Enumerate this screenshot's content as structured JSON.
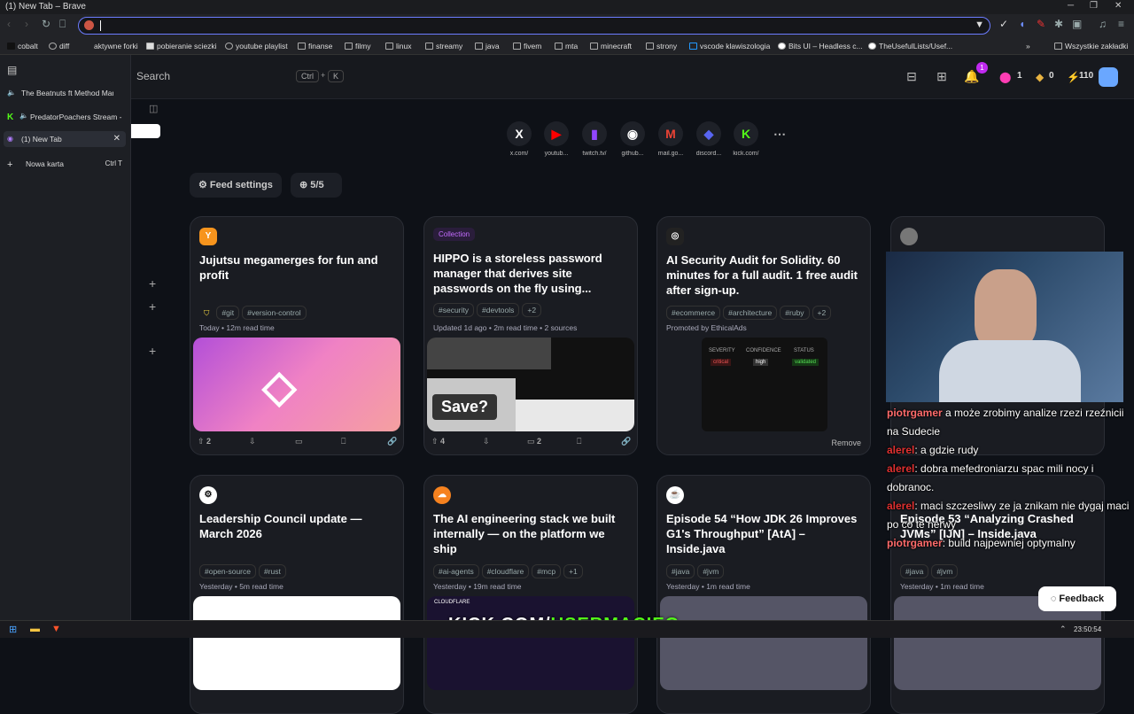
{
  "window": {
    "title": "(1) New Tab – Brave"
  },
  "bookmarks": [
    "cobalt",
    "diff",
    "aktywne forki",
    "pobieranie sciezki",
    "youtube playlist",
    "finanse",
    "filmy",
    "linux",
    "streamy",
    "java",
    "fivem",
    "mta",
    "minecraft",
    "strony",
    "vscode klawiszologia",
    "Bits UI – Headless c...",
    "TheUsefulLists/Usef...",
    "Wszystkie zakładki"
  ],
  "sidebar": {
    "tabs": [
      "The Beatnuts ft Method Man -",
      "PredatorPoachers Stream -",
      "(1) New Tab"
    ],
    "new_tab": "Nowa karta",
    "new_tab_kbd": "Ctrl  T"
  },
  "header": {
    "search": "Search",
    "kbd1": "Ctrl",
    "kbd_plus": "+",
    "kbd2": "K",
    "notif_count": "1",
    "stat_reputation": "1",
    "stat_coins": "0",
    "stat_cores": "110"
  },
  "shortcuts": [
    {
      "name": "x.com/",
      "glyph": "X",
      "color": "#ffffff"
    },
    {
      "name": "youtub...",
      "glyph": "▶",
      "color": "#ff0000"
    },
    {
      "name": "twitch.tv/",
      "glyph": "▮",
      "color": "#9146ff"
    },
    {
      "name": "github...",
      "glyph": "◉",
      "color": "#ffffff"
    },
    {
      "name": "mail.go...",
      "glyph": "M",
      "color": "#ea4335"
    },
    {
      "name": "discord...",
      "glyph": "◆",
      "color": "#5865f2"
    },
    {
      "name": "kick.com/",
      "glyph": "K",
      "color": "#53fc18"
    }
  ],
  "feed": {
    "settings": "Feed settings",
    "count": "5/5",
    "feedback": "Feedback"
  },
  "cards": [
    {
      "title": "Jujutsu megamerges for fun and profit",
      "tags": [
        "#git",
        "#version-control"
      ],
      "meta": "Today • 12m read time",
      "up": "2",
      "comments": ""
    },
    {
      "label": "Collection",
      "title": "HIPPO is a storeless password manager that derives site passwords on the fly using...",
      "tags": [
        "#security",
        "#devtools",
        "+2"
      ],
      "meta": "Updated 1d ago • 2m read time • 2 sources",
      "up": "4",
      "comments": "2",
      "save": "Save?"
    },
    {
      "title": "AI Security Audit for Solidity. 60 minutes for a full audit. 1 free audit after sign-up.",
      "tags": [
        "#ecommerce",
        "#architecture",
        "#ruby",
        "+2"
      ],
      "meta": "Promoted by EthicalAds",
      "remove": "Remove",
      "sev": "SEVERITY",
      "conf": "CONFIDENCE",
      "stat": "STATUS",
      "v1": "critical",
      "v2": "high",
      "v3": "validated"
    },
    {
      "title": "Leadership Council update — March 2026",
      "tags": [
        "#open-source",
        "#rust"
      ],
      "meta": "Yesterday • 5m read time"
    },
    {
      "title": "The AI engineering stack we built internally — on the platform we ship",
      "tags": [
        "#ai-agents",
        "#cloudflare",
        "#mcp",
        "+1"
      ],
      "meta": "Yesterday • 19m read time",
      "thumb_text": "CLOUDFLARE"
    },
    {
      "title": "Episode 54 “How JDK 26 Improves G1's Throughput” [AtA] – Inside.java",
      "tags": [
        "#java",
        "#jvm"
      ],
      "meta": "Yesterday • 1m read time"
    },
    {
      "title": "Episode 53 “Analyzing Crashed JVMs” [IJN] – Inside.java",
      "tags": [
        "#java",
        "#jvm"
      ],
      "meta": "Yesterday • 1m read time"
    }
  ],
  "chat": [
    {
      "user": "piotrgamer",
      "msg": "a może zrobimy analize rzezi rzeźnicii na Sudecie"
    },
    {
      "user": "alerel",
      "msg": "a gdzie rudy"
    },
    {
      "user": "alerel",
      "msg": "dobra mefedroniarzu     spac mili nocy i dobranoc."
    },
    {
      "user": "alerel",
      "msg": "maci szczesliwy ze ja znikam nie dygaj maci po co te nerwy"
    },
    {
      "user": "piotrgamer",
      "msg": "build najpewniej optymalny"
    }
  ],
  "overlay": {
    "a": "KICK.COM/",
    "b": "USERMACIEG"
  },
  "taskbar": {
    "time": "23:50:54"
  }
}
